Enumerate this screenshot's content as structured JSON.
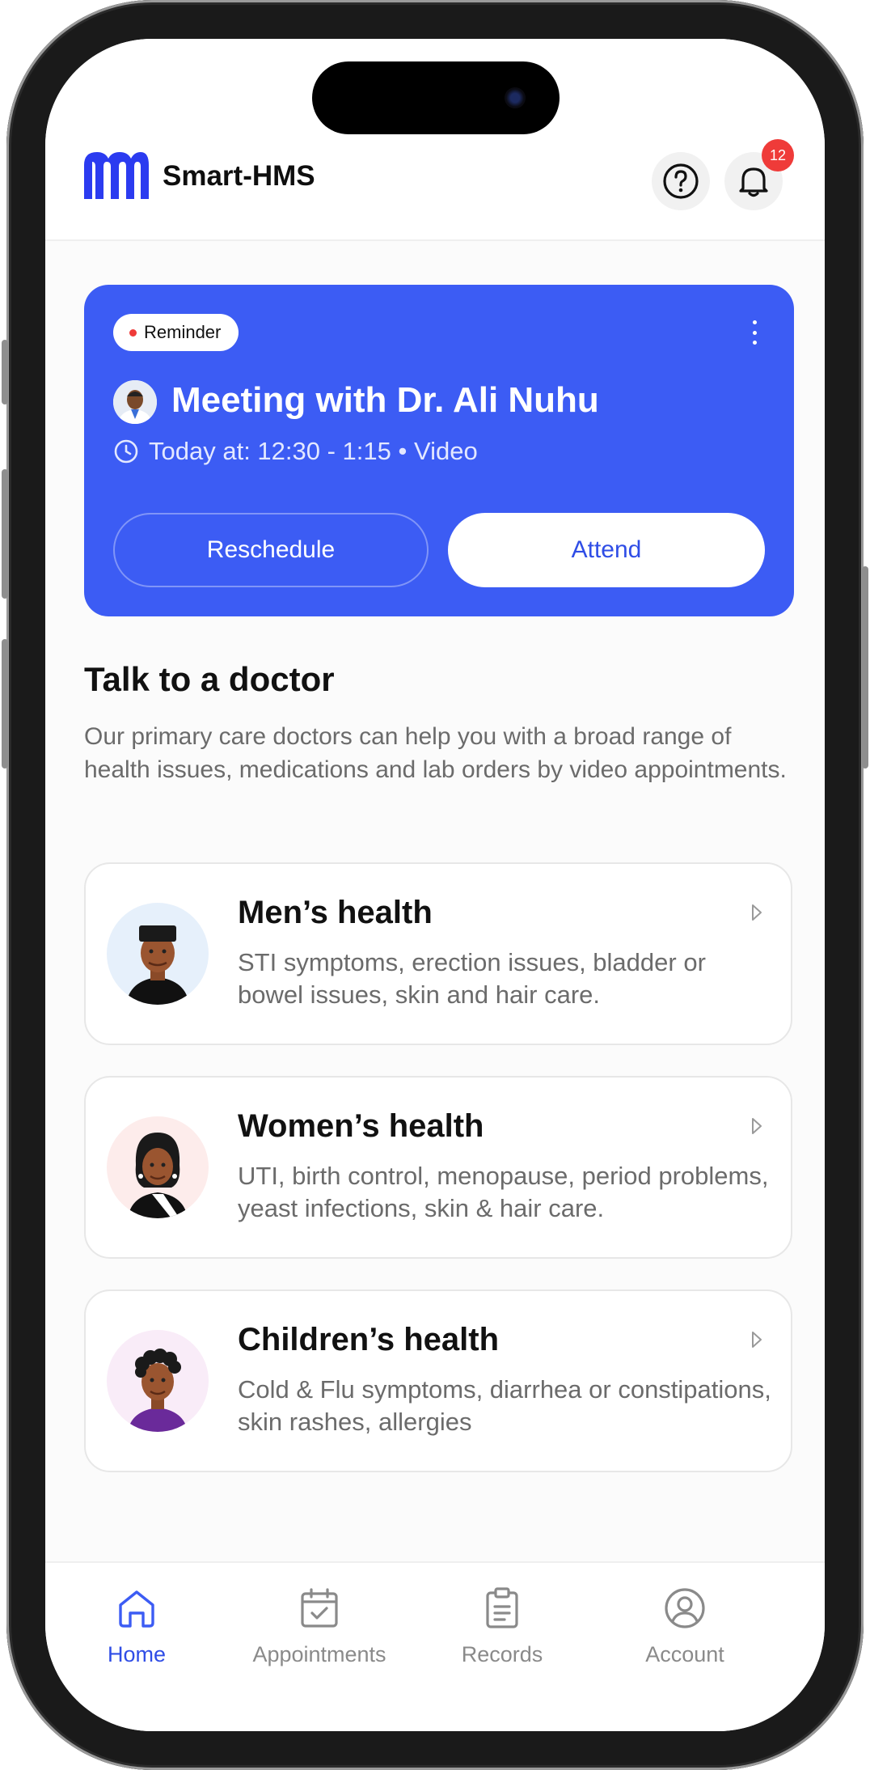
{
  "brand": {
    "name": "Smart-HMS",
    "accent": "#3c5cf4"
  },
  "header": {
    "notification_count": "12",
    "help_icon": "help-circle-icon",
    "bell_icon": "bell-icon"
  },
  "reminder": {
    "pill_label": "Reminder",
    "title": "Meeting with Dr. Ali Nuhu",
    "time": "Today at: 12:30 - 1:15 • Video",
    "reschedule_label": "Reschedule",
    "attend_label": "Attend"
  },
  "section": {
    "title": "Talk to a doctor",
    "description": "Our primary care doctors can help you with a broad range of health issues, medications and lab orders by video appointments."
  },
  "categories": [
    {
      "title": "Men’s health",
      "description": "STI symptoms, erection issues, bladder or bowel issues, skin and hair care."
    },
    {
      "title": "Women’s health",
      "description": "UTI, birth control, menopause, period problems, yeast infections, skin & hair care."
    },
    {
      "title": "Children’s health",
      "description": "Cold & Flu symptoms, diarrhea or constipations, skin rashes, allergies"
    }
  ],
  "nav": [
    {
      "label": "Home",
      "icon": "home-icon",
      "active": true
    },
    {
      "label": "Appointments",
      "icon": "calendar-check-icon",
      "active": false
    },
    {
      "label": "Records",
      "icon": "clipboard-icon",
      "active": false
    },
    {
      "label": "Account",
      "icon": "user-circle-icon",
      "active": false
    }
  ]
}
